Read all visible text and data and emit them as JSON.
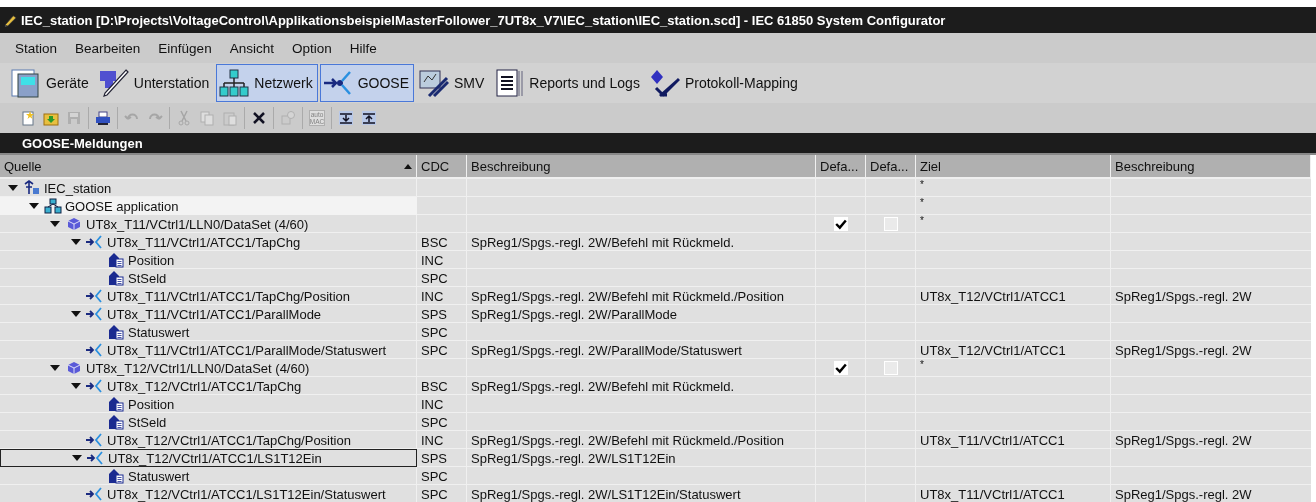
{
  "window": {
    "title": "IEC_station [D:\\Projects\\VoltageControl\\ApplikationsbeispielMasterFollower_7UT8x_V7\\IEC_station\\IEC_station.scd] - IEC 61850 System Configurator"
  },
  "menu": [
    "Station",
    "Bearbeiten",
    "Einfügen",
    "Ansicht",
    "Option",
    "Hilfe"
  ],
  "views": [
    {
      "label": "Geräte",
      "kind": "devices",
      "selected": false
    },
    {
      "label": "Unterstation",
      "kind": "substation",
      "selected": false
    },
    {
      "label": "Netzwerk",
      "kind": "network",
      "selected": true
    },
    {
      "label": "GOOSE",
      "kind": "goose",
      "selected": true
    },
    {
      "label": "SMV",
      "kind": "smv",
      "selected": false
    },
    {
      "label": "Reports und Logs",
      "kind": "reports",
      "selected": false
    },
    {
      "label": "Protokoll-Mapping",
      "kind": "mapping",
      "selected": false
    }
  ],
  "toolbar": [
    [
      {
        "kind": "new",
        "disabled": false
      },
      {
        "kind": "open",
        "disabled": false
      },
      {
        "kind": "save",
        "disabled": true
      }
    ],
    [
      {
        "kind": "print",
        "disabled": false
      }
    ],
    [
      {
        "kind": "undo",
        "disabled": true
      },
      {
        "kind": "redo",
        "disabled": true
      }
    ],
    [
      {
        "kind": "cut",
        "disabled": true
      },
      {
        "kind": "copy",
        "disabled": true
      },
      {
        "kind": "paste",
        "disabled": true
      }
    ],
    [
      {
        "kind": "delete",
        "disabled": false
      }
    ],
    [
      {
        "kind": "gear",
        "disabled": true
      }
    ],
    [
      {
        "kind": "mac",
        "disabled": true,
        "text": "auto MAC"
      }
    ],
    [
      {
        "kind": "expand",
        "disabled": false
      },
      {
        "kind": "collapse",
        "disabled": false
      }
    ]
  ],
  "section": {
    "title": "GOOSE-Meldungen"
  },
  "table": {
    "columns": [
      "Quelle",
      "CDC",
      "Beschreibung",
      "Defa...",
      "Defa...",
      "Ziel",
      "Beschreibung"
    ],
    "tree": [
      {
        "kind": "station",
        "label": "IEC_station",
        "expanded": true,
        "selected": false,
        "hot": false,
        "target": "*",
        "children": [
          {
            "kind": "application",
            "label": "GOOSE application",
            "expanded": true,
            "selected": false,
            "hot": true,
            "target": "*",
            "children": [
              {
                "kind": "dataset",
                "label": "UT8x_T11/VCtrl1/LLN0/DataSet  (4/60)",
                "expanded": true,
                "selected": false,
                "hot": false,
                "default_1": true,
                "default_2": false,
                "target": "*",
                "children": [
                  {
                    "kind": "goose",
                    "label": "UT8x_T11/VCtrl1/ATCC1/TapChg",
                    "cdc": "BSC",
                    "description": "SpReg1/Spgs.-regl. 2W/Befehl mit Rückmeld.",
                    "expanded": true,
                    "selected": false,
                    "hot": false,
                    "children": [
                      {
                        "kind": "data",
                        "label": "Position",
                        "cdc": "INC",
                        "selected": false,
                        "hot": false
                      },
                      {
                        "kind": "data",
                        "label": "StSeld",
                        "cdc": "SPC",
                        "selected": false,
                        "hot": false
                      }
                    ]
                  },
                  {
                    "kind": "goose",
                    "label": "UT8x_T11/VCtrl1/ATCC1/TapChg/Position",
                    "cdc": "INC",
                    "description": "SpReg1/Spgs.-regl. 2W/Befehl mit Rückmeld./Position",
                    "target": "UT8x_T12/VCtrl1/ATCC1",
                    "target_description": "SpReg1/Spgs.-regl. 2W",
                    "selected": false,
                    "hot": false
                  },
                  {
                    "kind": "goose",
                    "label": "UT8x_T11/VCtrl1/ATCC1/ParallMode",
                    "cdc": "SPS",
                    "description": "SpReg1/Spgs.-regl. 2W/ParallMode",
                    "expanded": true,
                    "selected": false,
                    "hot": false,
                    "children": [
                      {
                        "kind": "data",
                        "label": "Statuswert",
                        "cdc": "SPC",
                        "selected": false,
                        "hot": false
                      }
                    ]
                  },
                  {
                    "kind": "goose",
                    "label": "UT8x_T11/VCtrl1/ATCC1/ParallMode/Statuswert",
                    "cdc": "SPC",
                    "description": "SpReg1/Spgs.-regl. 2W/ParallMode/Statuswert",
                    "target": "UT8x_T12/VCtrl1/ATCC1",
                    "target_description": "SpReg1/Spgs.-regl. 2W",
                    "selected": false,
                    "hot": false
                  }
                ]
              },
              {
                "kind": "dataset",
                "label": "UT8x_T12/VCtrl1/LLN0/DataSet  (4/60)",
                "expanded": true,
                "selected": false,
                "hot": false,
                "default_1": true,
                "default_2": false,
                "target": "*",
                "children": [
                  {
                    "kind": "goose",
                    "label": "UT8x_T12/VCtrl1/ATCC1/TapChg",
                    "cdc": "BSC",
                    "description": "SpReg1/Spgs.-regl. 2W/Befehl mit Rückmeld.",
                    "expanded": true,
                    "selected": false,
                    "hot": false,
                    "children": [
                      {
                        "kind": "data",
                        "label": "Position",
                        "cdc": "INC",
                        "selected": false,
                        "hot": false
                      },
                      {
                        "kind": "data",
                        "label": "StSeld",
                        "cdc": "SPC",
                        "selected": false,
                        "hot": false
                      }
                    ]
                  },
                  {
                    "kind": "goose",
                    "label": "UT8x_T12/VCtrl1/ATCC1/TapChg/Position",
                    "cdc": "INC",
                    "description": "SpReg1/Spgs.-regl. 2W/Befehl mit Rückmeld./Position",
                    "target": "UT8x_T11/VCtrl1/ATCC1",
                    "target_description": "SpReg1/Spgs.-regl. 2W",
                    "selected": false,
                    "hot": false
                  },
                  {
                    "kind": "goose",
                    "label": "UT8x_T12/VCtrl1/ATCC1/LS1T12Ein",
                    "cdc": "SPS",
                    "description": "SpReg1/Spgs.-regl. 2W/LS1T12Ein",
                    "expanded": true,
                    "selected": true,
                    "hot": false,
                    "children": [
                      {
                        "kind": "data",
                        "label": "Statuswert",
                        "cdc": "SPC",
                        "selected": false,
                        "hot": false
                      }
                    ]
                  },
                  {
                    "kind": "goose",
                    "label": "UT8x_T12/VCtrl1/ATCC1/LS1T12Ein/Statuswert",
                    "cdc": "SPC",
                    "description": "SpReg1/Spgs.-regl. 2W/LS1T12Ein/Statuswert",
                    "target": "UT8x_T11/VCtrl1/ATCC1",
                    "target_description": "SpReg1/Spgs.-regl. 2W",
                    "selected": false,
                    "hot": false
                  }
                ]
              }
            ]
          }
        ]
      }
    ]
  }
}
